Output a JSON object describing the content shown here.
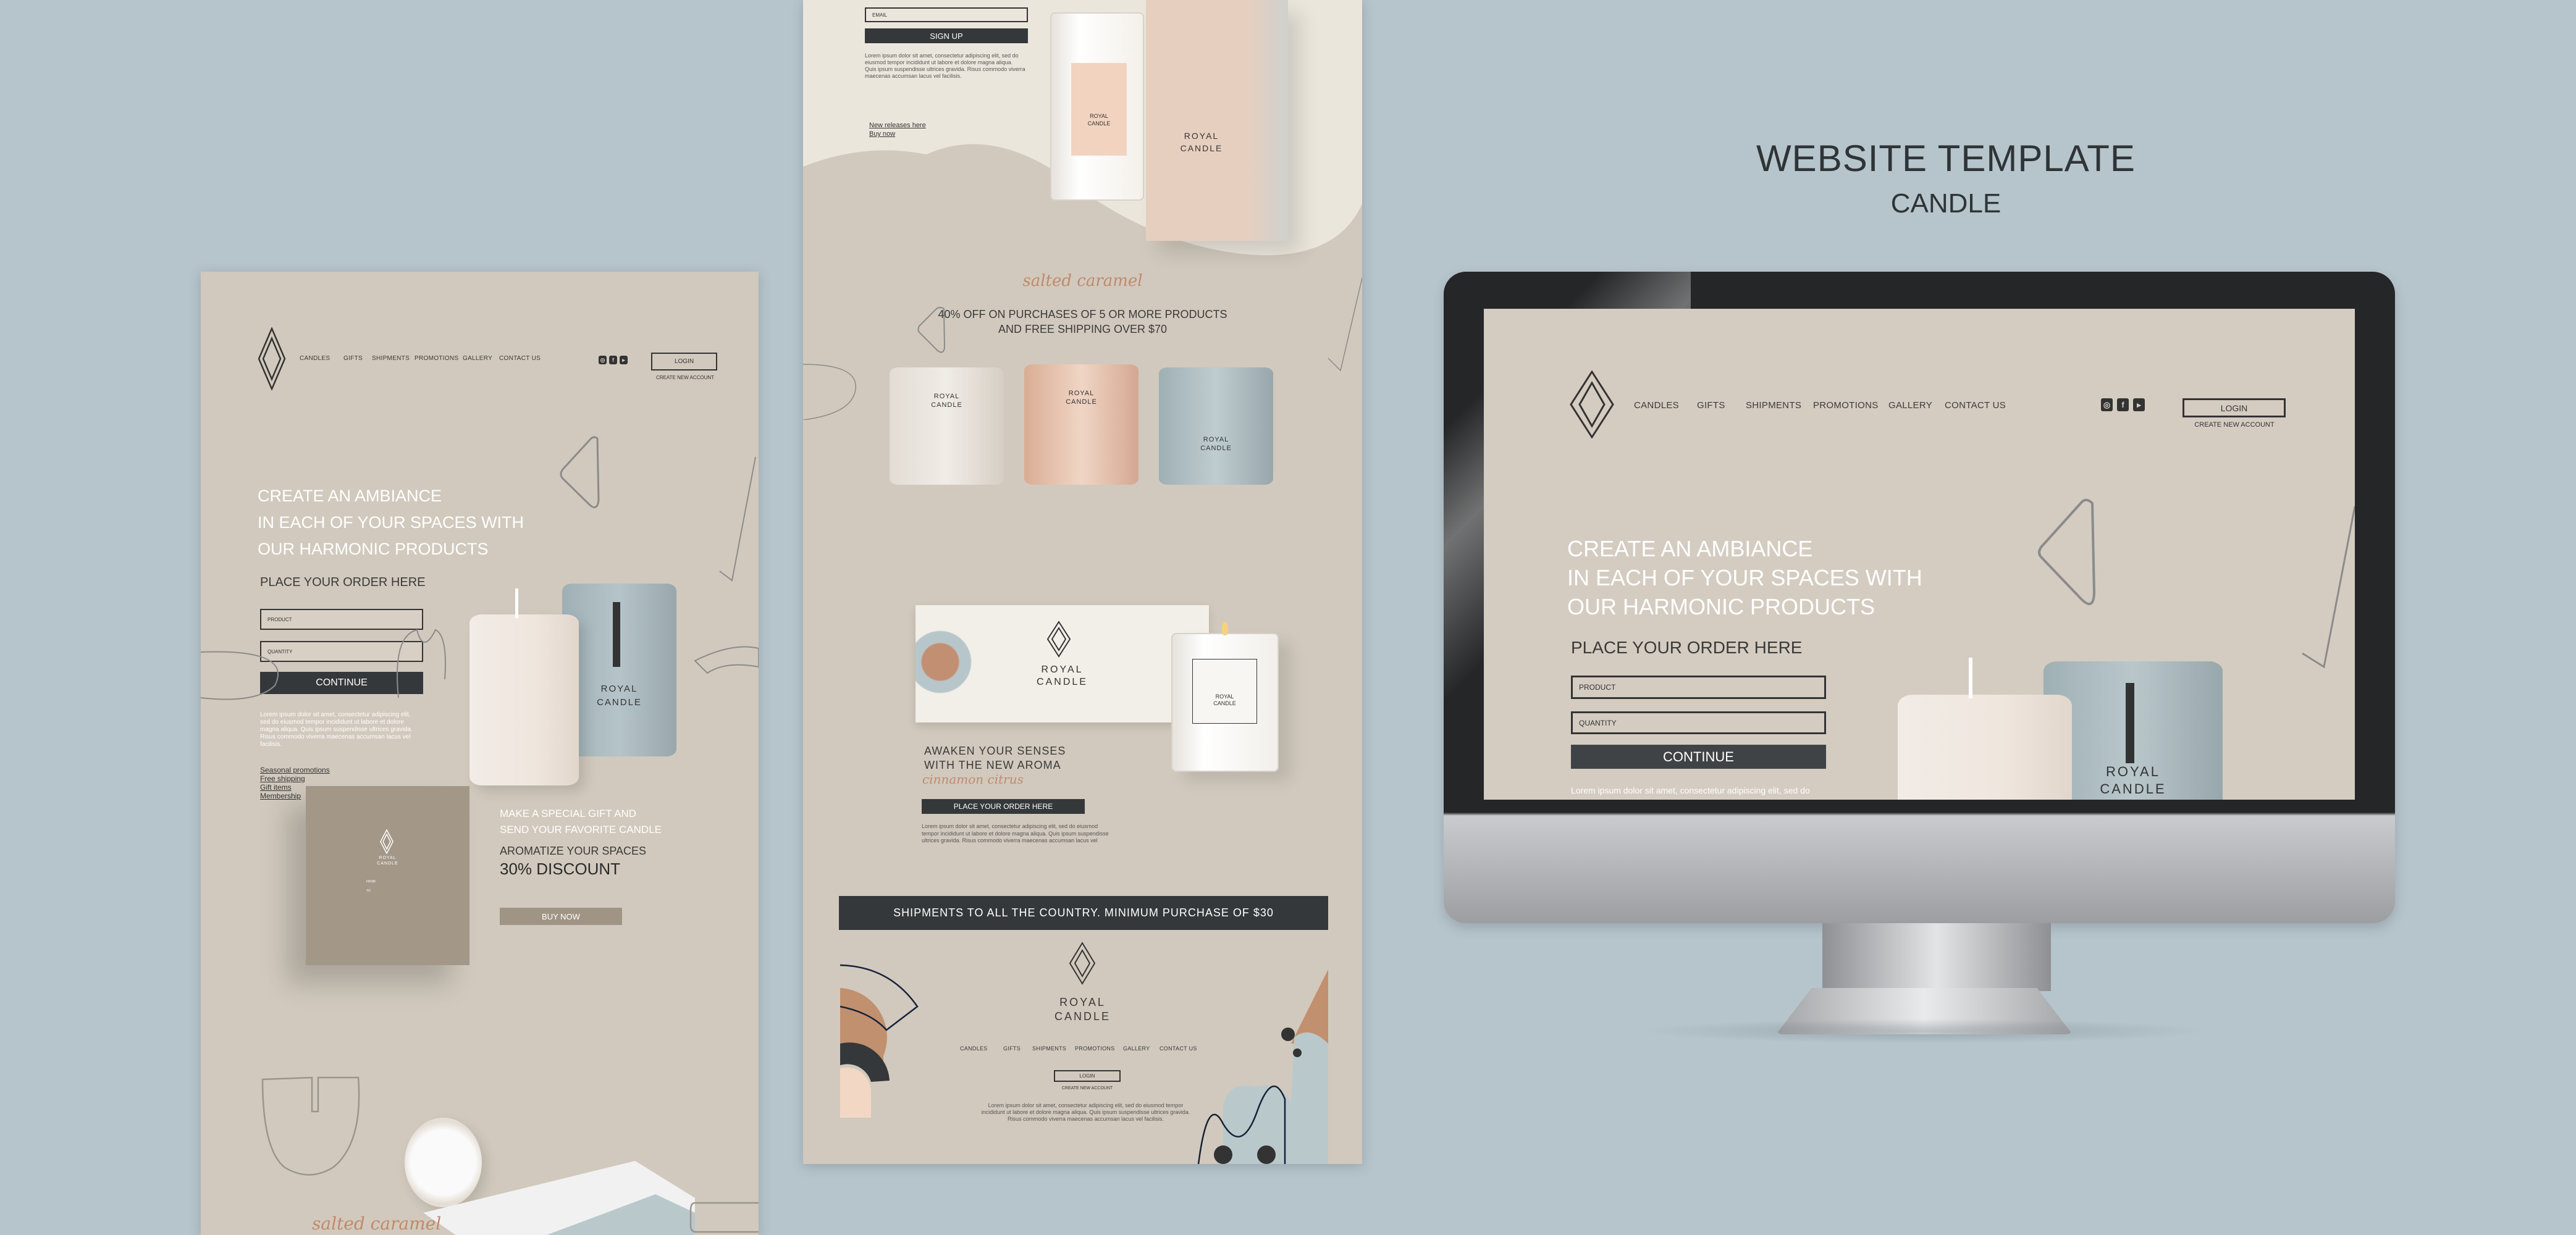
{
  "title": {
    "main": "WEBSITE TEMPLATE",
    "sub": "CANDLE"
  },
  "colors": {
    "background": "#b6c5cc",
    "panel": "#d1c9bd",
    "cream": "#ebe6dc",
    "dark": "#35383a",
    "accent": "#c08a6c",
    "blue": "#a9b9be",
    "taupe": "#a09585"
  },
  "nav": [
    "CANDLES",
    "GIFTS",
    "SHIPMENTS",
    "PROMOTIONS",
    "GALLERY",
    "CONTACT US"
  ],
  "social_icons": [
    "instagram-icon",
    "facebook-icon",
    "youtube-icon"
  ],
  "account": {
    "login": "LOGIN",
    "create": "CREATE NEW ACCOUNT"
  },
  "brand": {
    "line1": "ROYAL",
    "line2": "CANDLE",
    "flavor": "SALTED CARAMEL"
  },
  "hero": {
    "line1": "CREATE AN AMBIANCE",
    "line2": "IN EACH OF YOUR SPACES WITH",
    "line3": "OUR HARMONIC PRODUCTS",
    "order_title": "PLACE YOUR ORDER HERE",
    "product_placeholder": "PRODUCT",
    "quantity_placeholder": "QUANTITY",
    "continue": "CONTINUE",
    "lorem": "Lorem ipsum dolor sit amet, consectetur adipiscing elit, sed do eiusmod tempor incididunt ut labore et dolore magna aliqua. Quis ipsum suspendisse ultrices gravida. Risus commodo viverra maecenas accumsan lacus vel facilisis.",
    "links": [
      "Seasonal promotions",
      "Free shipping",
      "Gift items",
      "Membership"
    ]
  },
  "gift": {
    "line1": "MAKE A SPECIAL GIFT AND",
    "line2": "SEND YOUR FAVORITE CANDLE",
    "aromatize": "AROMATIZE YOUR SPACES",
    "discount": "30% DISCOUNT",
    "buy": "BUY NOW",
    "from": "FROM",
    "to": "TO"
  },
  "salted_caramel": "salted caramel",
  "signup": {
    "email_placeholder": "EMAIL",
    "button": "SIGN UP",
    "lorem": "Lorem ipsum dolor sit amet, consectetur adipiscing elit, sed do eiusmod tempor incididunt ut labore et dolore magna aliqua. Quis ipsum suspendisse ultrices gravida. Risus commodo viverra maecenas accumsan lacus vel facilisis.",
    "links": [
      "New releases here",
      "Buy now"
    ]
  },
  "promo": {
    "line1": "40% OFF ON PURCHASES OF 5 OR MORE PRODUCTS",
    "line2": "AND FREE SHIPPING OVER $70"
  },
  "aroma": {
    "line1": "AWAKEN YOUR SENSES",
    "line2": "WITH THE NEW AROMA",
    "script": "cinnamon citrus",
    "button": "PLACE YOUR ORDER HERE",
    "lorem": "Lorem ipsum dolor sit amet, consectetur adipiscing elit, sed do eiusmod tempor incididunt ut labore et dolore magna aliqua. Quis ipsum suspendisse ultrices gravida. Risus commodo viverra maecenas accumsan lacus vel"
  },
  "shipping_banner": "SHIPMENTS TO ALL THE COUNTRY. MINIMUM PURCHASE OF $30",
  "footer": {
    "lorem": "Lorem ipsum dolor sit amet, consectetur adipiscing elit, sed do eiusmod tempor incididunt ut labore et dolore magna aliqua. Quis ipsum suspendisse ultrices gravida. Risus commodo viverra maecenas accumsan lacus vel facilisis."
  },
  "monitor_lorem": "Lorem ipsum dolor sit amet, consectetur adipiscing elit, sed do"
}
